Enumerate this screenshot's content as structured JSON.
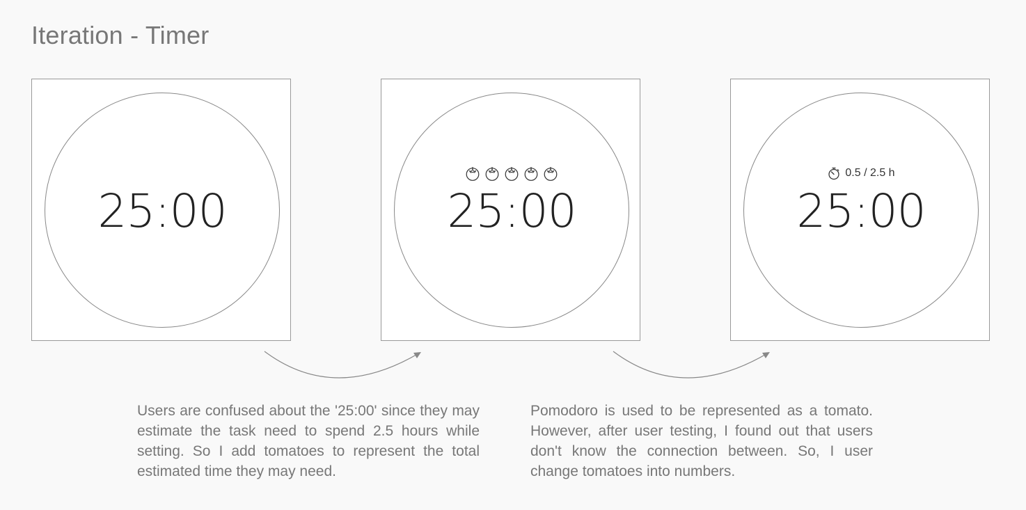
{
  "page": {
    "title": "Iteration - Timer"
  },
  "timers": [
    {
      "time": "25:00"
    },
    {
      "time": "25:00",
      "tomato_count": 5,
      "icon": "tomato-icon"
    },
    {
      "time": "25:00",
      "icon": "stopwatch-icon",
      "estimate": "0.5 / 2.5 h"
    }
  ],
  "notes": [
    "Users are confused about the '25:00' since they may estimate the task need to spend 2.5 hours while setting. So I add tomatoes to represent the total estimated time they may need.",
    "Pomodoro is used to be represented as a tomato. However, after user testing, I found out that users don't know the connection between. So, I user change tomatoes into numbers."
  ],
  "colors": {
    "background": "#f9f9f9",
    "frame": "#ffffff",
    "stroke": "#888888",
    "text": "#777777"
  }
}
